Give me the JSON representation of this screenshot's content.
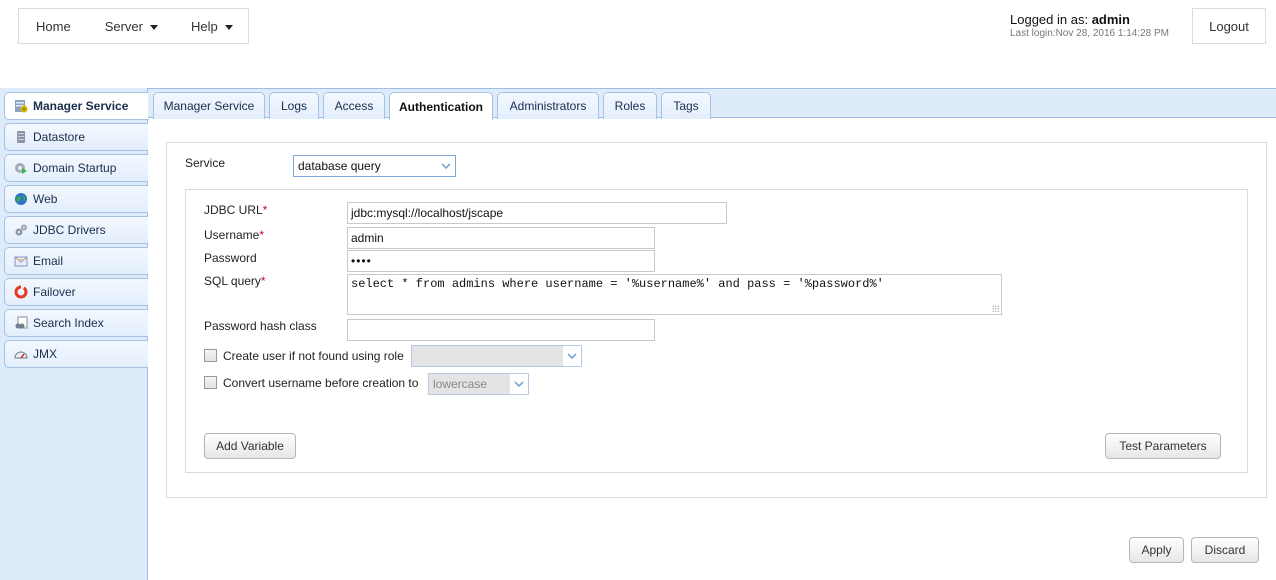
{
  "topnav": {
    "items": [
      {
        "label": "Home",
        "has_dropdown": false
      },
      {
        "label": "Server",
        "has_dropdown": true
      },
      {
        "label": "Help",
        "has_dropdown": true
      }
    ]
  },
  "session": {
    "logged_in_prefix": "Logged in as: ",
    "username": "admin",
    "last_login": "Last login:Nov 28, 2016 1:14:28 PM",
    "logout_label": "Logout"
  },
  "sidebar": {
    "active": "Manager Service",
    "items": [
      {
        "label": "Manager Service",
        "icon": "server-icon"
      },
      {
        "label": "Datastore",
        "icon": "database-icon"
      },
      {
        "label": "Domain Startup",
        "icon": "gear-play-icon"
      },
      {
        "label": "Web",
        "icon": "globe-icon"
      },
      {
        "label": "JDBC Drivers",
        "icon": "gears-icon"
      },
      {
        "label": "Email",
        "icon": "envelope-icon"
      },
      {
        "label": "Failover",
        "icon": "lifebuoy-icon"
      },
      {
        "label": "Search Index",
        "icon": "document-search-icon"
      },
      {
        "label": "JMX",
        "icon": "gauge-icon"
      }
    ]
  },
  "tabs": {
    "active": "Authentication",
    "items": [
      "Manager Service",
      "Logs",
      "Access",
      "Authentication",
      "Administrators",
      "Roles",
      "Tags"
    ]
  },
  "form": {
    "service_label": "Service",
    "service_value": "database query",
    "jdbc_url_label": "JDBC URL",
    "jdbc_url_value": "jdbc:mysql://localhost/jscape",
    "username_label": "Username",
    "username_value": "admin",
    "password_label": "Password",
    "password_value": "••••",
    "sql_query_label": "SQL query",
    "sql_query_value": "select * from admins where username = '%username%' and pass = '%password%'",
    "hash_class_label": "Password hash class",
    "hash_class_value": "",
    "required_marker": "*",
    "create_user_label": "Create user if not found using role",
    "create_user_checked": false,
    "create_user_role_value": "",
    "convert_label": "Convert username before creation to",
    "convert_checked": false,
    "convert_value": "lowercase",
    "add_variable_label": "Add Variable",
    "test_parameters_label": "Test Parameters"
  },
  "footer": {
    "apply_label": "Apply",
    "discard_label": "Discard"
  },
  "colors": {
    "panel_blue": "#deebfb",
    "border_blue": "#9dbde4",
    "required_red": "#d0021b"
  }
}
